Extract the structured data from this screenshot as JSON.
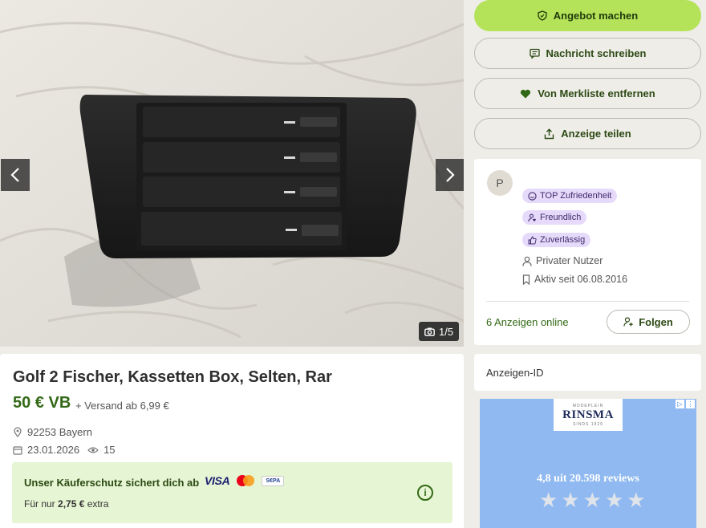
{
  "gallery": {
    "counter": "1/5"
  },
  "listing": {
    "title": "Golf 2 Fischer, Kassetten Box, Selten, Rar",
    "price": "50 € VB",
    "shipping": "+ Versand ab 6,99 €",
    "location": "92253 Bayern",
    "date": "23.01.2026",
    "views": "15"
  },
  "protection": {
    "title": "Unser Käuferschutz sichert dich ab",
    "visa": "VISA",
    "sepa": "S€PA",
    "sub_prefix": "Für nur",
    "fee": "2,75 €",
    "sub_suffix": "extra"
  },
  "actions": {
    "offer": "Angebot machen",
    "message": "Nachricht schreiben",
    "watchlist": "Von Merkliste entfernen",
    "share": "Anzeige teilen"
  },
  "seller": {
    "initial": "P",
    "badges": [
      "TOP Zufriedenheit",
      "Freundlich",
      "Zuverlässig"
    ],
    "type": "Privater Nutzer",
    "active_since": "Aktiv seit 06.08.2016",
    "ads_online": "6 Anzeigen online",
    "follow": "Folgen"
  },
  "ad_id": {
    "label": "Anzeigen-ID"
  },
  "advert": {
    "brand_small": "MODEPLEIN",
    "brand": "RINSMA",
    "brand_tag": "SINDS 1929",
    "reviews": "4,8 uit 20.598 reviews"
  },
  "colors": {
    "accent": "#b4e35a",
    "brand_green": "#326916",
    "badge_bg": "#e6dafb",
    "protection_bg": "#e6f5d3"
  }
}
